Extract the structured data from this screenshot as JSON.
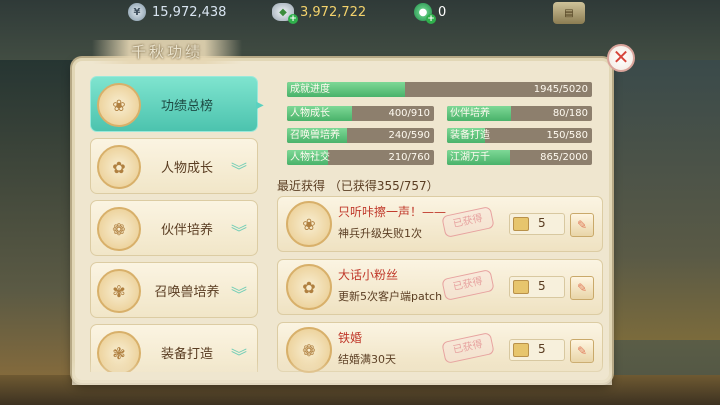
{
  "currencies": {
    "silver": {
      "icon": "silver-coin-icon",
      "value": "15,972,438"
    },
    "gold": {
      "icon": "gold-ingot-icon",
      "value": "3,972,722"
    },
    "jade": {
      "icon": "jade-icon",
      "value": "0"
    }
  },
  "panel": {
    "title": "千秋功绩"
  },
  "nav": {
    "items": [
      {
        "label": "功绩总榜",
        "active": true
      },
      {
        "label": "人物成长"
      },
      {
        "label": "伙伴培养"
      },
      {
        "label": "召唤兽培养"
      },
      {
        "label": "装备打造"
      }
    ]
  },
  "progress": {
    "overall": {
      "label": "成就进度",
      "current": 1945,
      "total": 5020,
      "text": "1945/5020"
    },
    "categories": [
      {
        "label": "人物成长",
        "current": 400,
        "total": 910,
        "text": "400/910"
      },
      {
        "label": "伙伴培养",
        "current": 80,
        "total": 180,
        "text": "80/180"
      },
      {
        "label": "召唤兽培养",
        "current": 240,
        "total": 590,
        "text": "240/590"
      },
      {
        "label": "装备打造",
        "current": 150,
        "total": 580,
        "text": "150/580"
      },
      {
        "label": "人物社交",
        "current": 210,
        "total": 760,
        "text": "210/760"
      },
      {
        "label": "江湖万千",
        "current": 865,
        "total": 2000,
        "text": "865/2000"
      }
    ]
  },
  "recent": {
    "heading": "最近获得 （已获得355/757）",
    "stamp": "已获得",
    "items": [
      {
        "title": "只听咔擦一声！——",
        "desc": "神兵升级失败1次",
        "reward": "5"
      },
      {
        "title": "大话小粉丝",
        "desc": "更新5次客户端patch",
        "reward": "5"
      },
      {
        "title": "铁婚",
        "desc": "结婚满30天",
        "reward": "5"
      }
    ]
  }
}
